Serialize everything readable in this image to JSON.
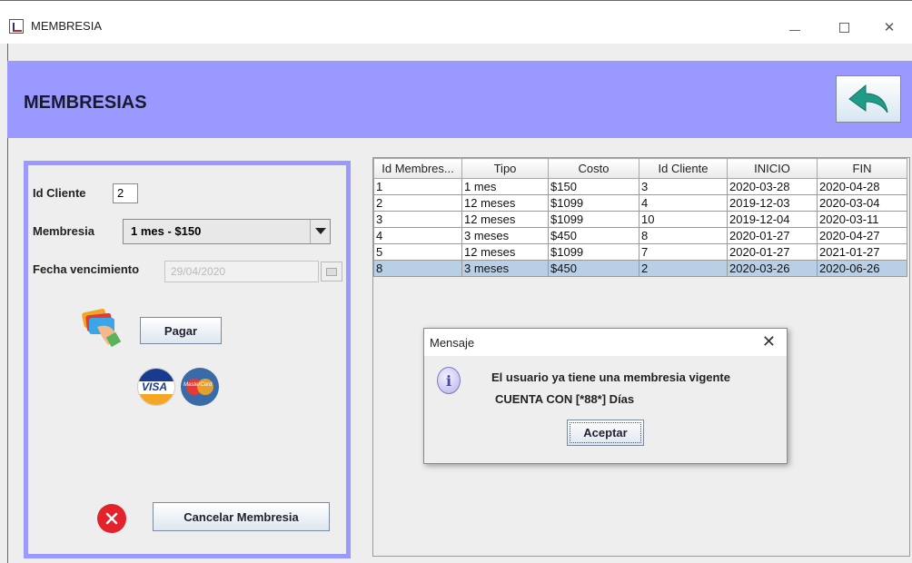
{
  "window": {
    "title": "MEMBRESIA",
    "minimize": "—",
    "maximize": "☐",
    "close": "✕"
  },
  "header": {
    "title": "MEMBRESIAS",
    "back_icon": "back-arrow-icon",
    "accent": "#9999ff"
  },
  "form": {
    "id_cliente_label": "Id Cliente",
    "id_cliente_value": "2",
    "membresia_label": "Membresia",
    "membresia_value": "1 mes - $150",
    "fecha_label": "Fecha vencimiento",
    "fecha_value": "29/04/2020",
    "pagar_label": "Pagar",
    "cancelar_label": "Cancelar Membresia",
    "visa_text": "VISA",
    "mastercard_text": "MasterCard"
  },
  "table": {
    "columns": [
      "Id Membres...",
      "Tipo",
      "Costo",
      "Id Cliente",
      "INICIO",
      "FIN"
    ],
    "rows": [
      [
        "1",
        "1 mes",
        "$150",
        "3",
        "2020-03-28",
        "2020-04-28"
      ],
      [
        "2",
        "12 meses",
        "$1099",
        "4",
        "2019-12-03",
        "2020-03-04"
      ],
      [
        "3",
        "12 meses",
        "$1099",
        "10",
        "2019-12-04",
        "2020-03-11"
      ],
      [
        "4",
        "3 meses",
        "$450",
        "8",
        "2020-01-27",
        "2020-04-27"
      ],
      [
        "5",
        "12 meses",
        "$1099",
        "7",
        "2020-01-27",
        "2021-01-27"
      ],
      [
        "8",
        "3 meses",
        "$450",
        "2",
        "2020-03-26",
        "2020-06-26"
      ]
    ],
    "selected_row": 5
  },
  "dialog": {
    "title": "Mensaje",
    "close": "✕",
    "line1": "El usuario ya tiene una membresia vigente",
    "line2": "CUENTA CON [*88*] Días",
    "ok_label": "Aceptar",
    "icon": "info-icon"
  }
}
